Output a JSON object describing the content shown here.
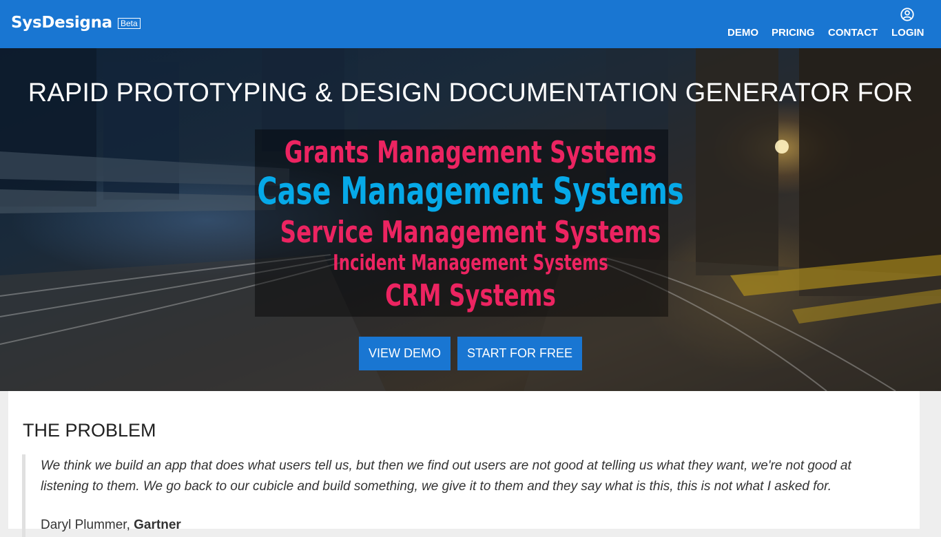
{
  "header": {
    "brand": "SysDesigna",
    "badge": "Beta",
    "nav": {
      "demo": "DEMO",
      "pricing": "PRICING",
      "contact": "CONTACT",
      "login": "LOGIN"
    },
    "account_icon": "account-circle-icon"
  },
  "hero": {
    "title": "RAPID PROTOTYPING & DESIGN DOCUMENTATION GENERATOR FOR",
    "systems": [
      {
        "label": "Grants Management Systems",
        "color": "#ec2461"
      },
      {
        "label": "Case Management Systems",
        "color": "#06a9e8"
      },
      {
        "label": "Service Management Systems",
        "color": "#ec2461"
      },
      {
        "label": "Incident Management Systems",
        "color": "#ec2461"
      },
      {
        "label": "CRM Systems",
        "color": "#ec2461"
      }
    ],
    "buttons": {
      "view_demo": "VIEW DEMO",
      "start_free": "START FOR FREE"
    }
  },
  "problem": {
    "title": "THE PROBLEM",
    "quote": "We think we build an app that does what users tell us, but then we find out users are not good at telling us what they want, we're not good at listening to them. We go back to our cubicle and build something, we give it to them and they say what is this, this is not what I asked for.",
    "author": "Daryl Plummer,",
    "organization": "Gartner"
  },
  "colors": {
    "primary": "#1976d2",
    "accent_pink": "#ec2461",
    "accent_blue": "#06a9e8"
  }
}
